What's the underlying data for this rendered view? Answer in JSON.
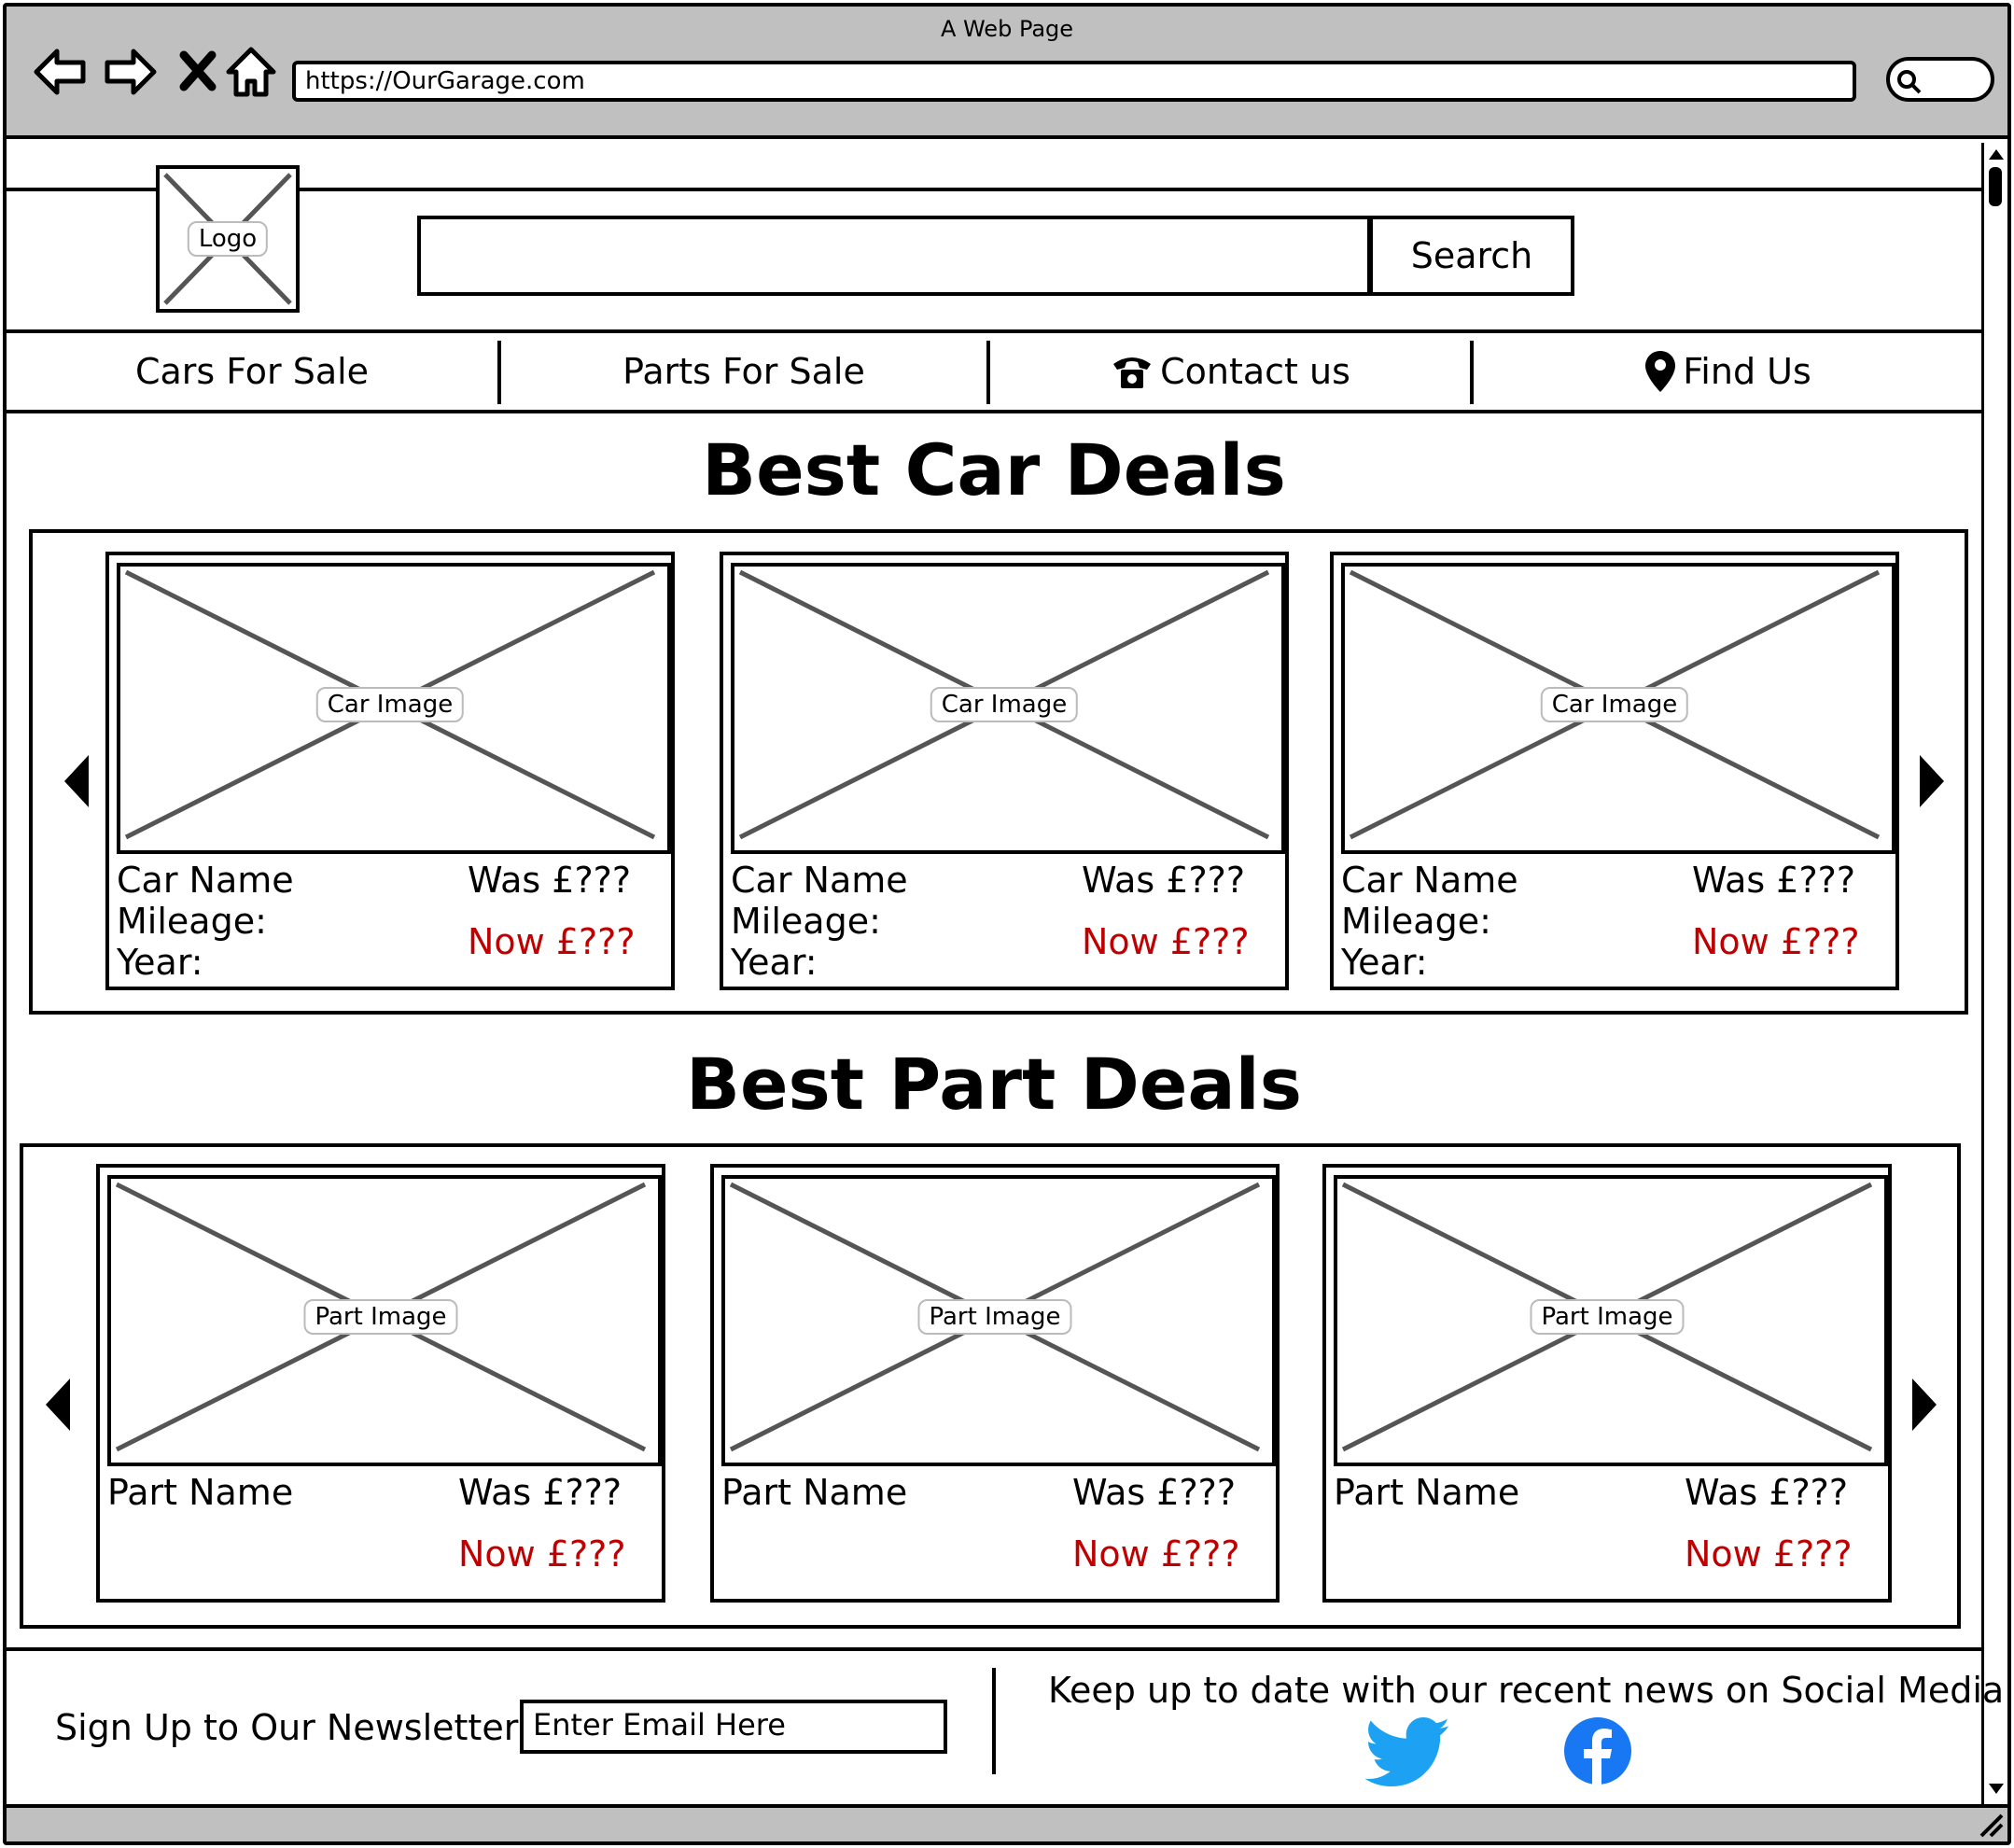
{
  "browser": {
    "window_title": "A Web Page",
    "url": "https://OurGarage.com",
    "nav_buttons": [
      "back-arrow-icon",
      "forward-arrow-icon",
      "close-icon",
      "home-icon"
    ]
  },
  "header": {
    "logo_label": "Logo",
    "search_button_label": "Search"
  },
  "nav": {
    "items": [
      {
        "label": "Cars For Sale",
        "icon": ""
      },
      {
        "label": "Parts For Sale",
        "icon": ""
      },
      {
        "label": "Contact us",
        "icon": "telephone-icon"
      },
      {
        "label": "Find Us",
        "icon": "map-pin-icon"
      }
    ]
  },
  "car_deals": {
    "title": "Best Car Deals",
    "cards": [
      {
        "image_label": "Car Image",
        "name": "Car Name",
        "mileage": "Mileage:",
        "year": "Year:",
        "was": "Was £???",
        "now": "Now £???"
      },
      {
        "image_label": "Car Image",
        "name": "Car Name",
        "mileage": "Mileage:",
        "year": "Year:",
        "was": "Was £???",
        "now": "Now £???"
      },
      {
        "image_label": "Car Image",
        "name": "Car Name",
        "mileage": "Mileage:",
        "year": "Year:",
        "was": "Was £???",
        "now": "Now £???"
      }
    ]
  },
  "part_deals": {
    "title": "Best Part Deals",
    "cards": [
      {
        "image_label": "Part Image",
        "name": "Part Name",
        "was": "Was £???",
        "now": "Now £???"
      },
      {
        "image_label": "Part Image",
        "name": "Part Name",
        "was": "Was £???",
        "now": "Now £???"
      },
      {
        "image_label": "Part Image",
        "name": "Part Name",
        "was": "Was £???",
        "now": "Now £???"
      }
    ]
  },
  "footer": {
    "newsletter_label": "Sign Up to Our Newsletter:",
    "email_placeholder": "Enter Email Here",
    "social_text": "Keep up to date with our recent news on Social Media",
    "social_icons": [
      "twitter-icon",
      "facebook-icon"
    ]
  },
  "colors": {
    "price_now": "#c00000",
    "chrome": "#c0c0c0",
    "twitter": "#1da1f2",
    "facebook": "#1877f2"
  }
}
